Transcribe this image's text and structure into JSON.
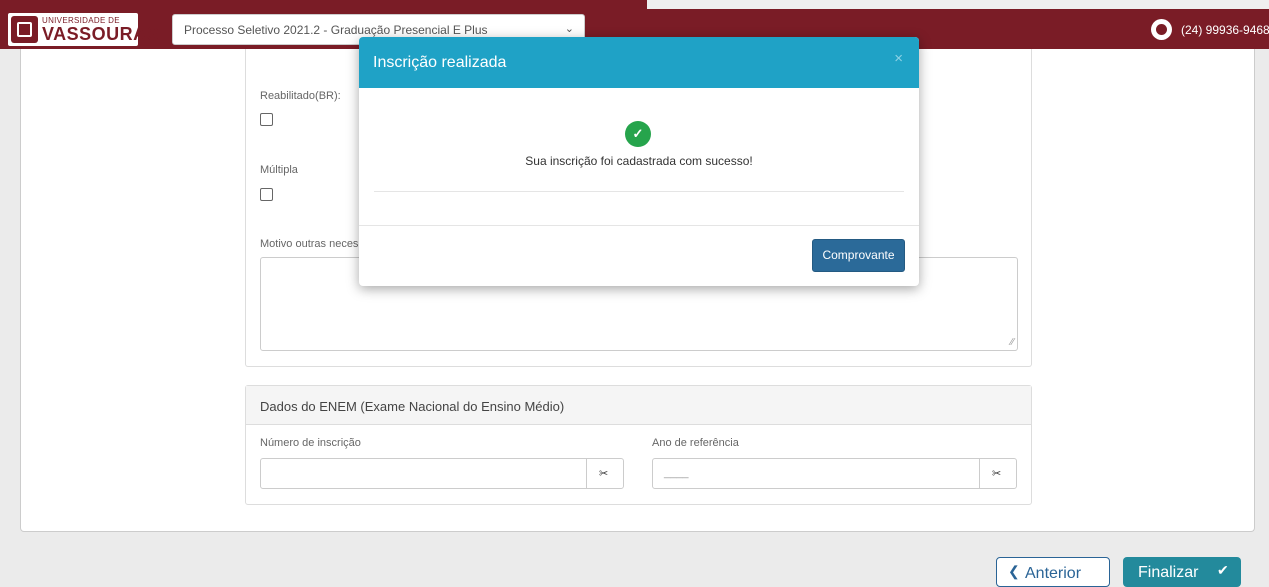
{
  "header": {
    "logo_small": "UNIVERSIDADE DE",
    "logo_big": "VASSOURAS",
    "process_select_value": "Processo Seletivo 2021.2 - Graduação Presencial E Plus",
    "phone_icon": "whatsapp-icon",
    "phone_number": "(24) 99936-9468"
  },
  "form": {
    "reabilitado_label": "Reabilitado(BR):",
    "multipla_label": "Múltipla",
    "motivo_label": "Motivo outras neces"
  },
  "enem": {
    "title": "Dados do ENEM (Exame Nacional do Ensino Médio)",
    "numero_label": "Número de inscrição",
    "ano_label": "Ano de referência",
    "ano_placeholder": "____",
    "eraser_icon": "eraser-icon"
  },
  "nav": {
    "prev_label": "Anterior",
    "next_label": "Finalizar"
  },
  "modal": {
    "title": "Inscrição realizada",
    "close_symbol": "×",
    "success_icon": "check-circle-icon",
    "message": "Sua inscrição foi cadastrada com sucesso!",
    "comprovante_label": "Comprovante"
  },
  "colors": {
    "header_bg": "#7a1c26",
    "modal_header": "#1fa2c6",
    "success": "#26a44c",
    "primary_button": "#2b6a99"
  }
}
